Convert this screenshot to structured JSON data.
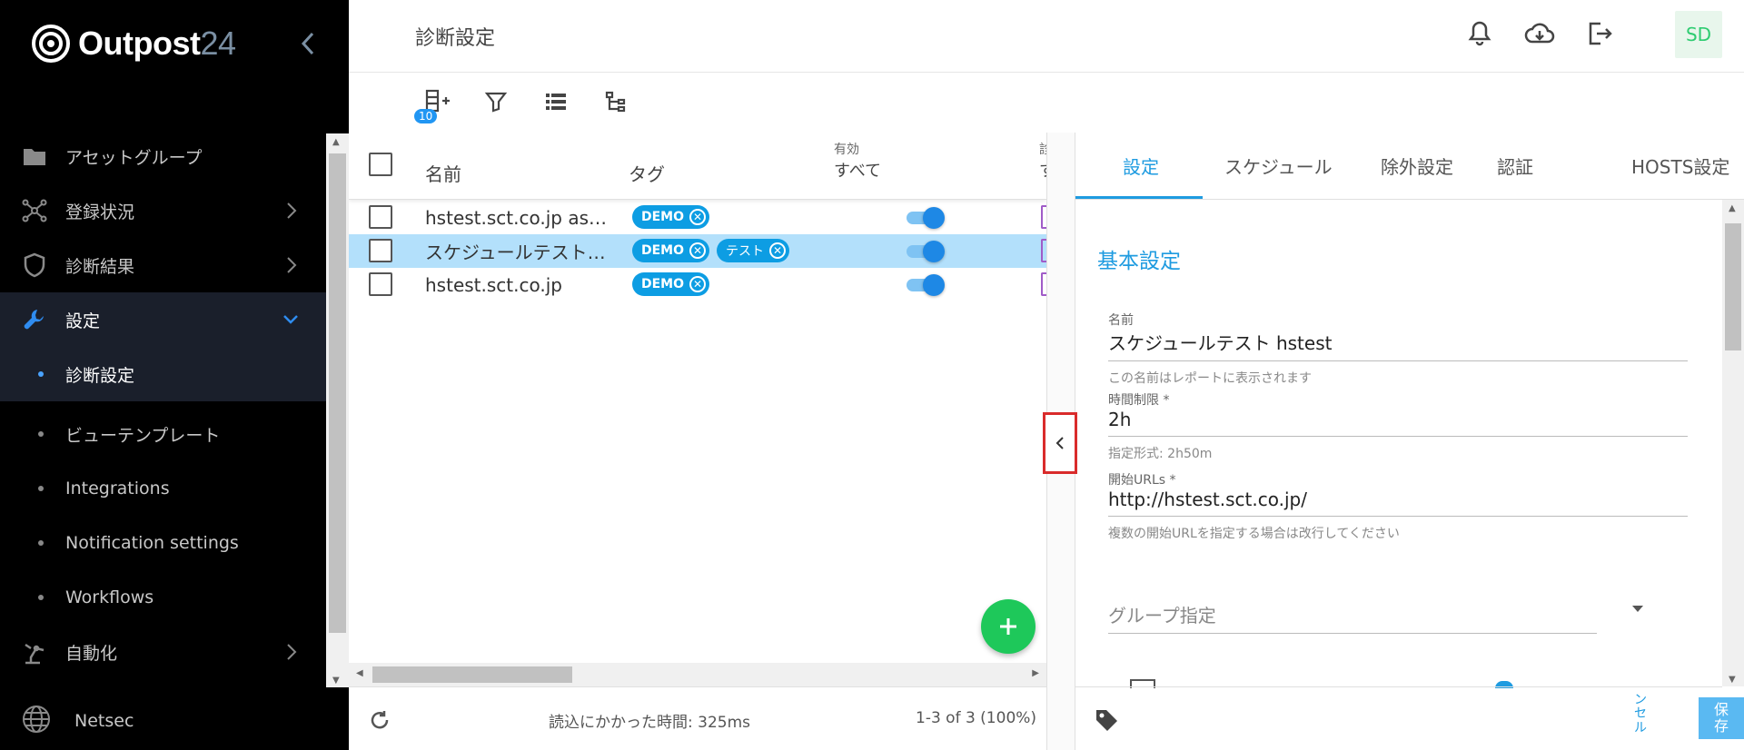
{
  "brand": {
    "name": "Outpost",
    "num": "24"
  },
  "sidebar": {
    "items": [
      {
        "label": "アセットグループ"
      },
      {
        "label": "登録状況"
      },
      {
        "label": "診断結果"
      },
      {
        "label": "設定"
      }
    ],
    "sub_items": [
      {
        "label": "診断設定"
      },
      {
        "label": "ビューテンプレート"
      },
      {
        "label": "Integrations"
      },
      {
        "label": "Notification settings"
      },
      {
        "label": "Workflows"
      }
    ],
    "automation": {
      "label": "自動化"
    },
    "netsec": {
      "label": "Netsec"
    }
  },
  "header": {
    "title": "診断設定",
    "avatar": "SD"
  },
  "toolbar": {
    "badge": "10"
  },
  "table": {
    "headers": {
      "select": "",
      "name": "名前",
      "tag": "タグ",
      "active_label": "有効",
      "active_filter": "すべて",
      "cut_label": "診",
      "cut_filter": "す"
    },
    "rows": [
      {
        "name": "hstest.sct.co.jp asset...",
        "tags": [
          "DEMO"
        ],
        "enabled": true
      },
      {
        "name": "スケジュールテスト ...",
        "tags": [
          "DEMO",
          "テスト"
        ],
        "enabled": true
      },
      {
        "name": "hstest.sct.co.jp",
        "tags": [
          "DEMO"
        ],
        "enabled": true
      }
    ]
  },
  "footer": {
    "load_time": "読込にかかった時間: 325ms",
    "count": "1-3 of 3 (100%)"
  },
  "panel": {
    "tabs": [
      "設定",
      "スケジュール",
      "除外設定",
      "認証",
      "HOSTS設定"
    ],
    "section": "基本設定",
    "fields": [
      {
        "label": "名前",
        "value": "スケジュールテスト hstest",
        "hint": "この名前はレポートに表示されます"
      },
      {
        "label": "時間制限 *",
        "value": "2h",
        "hint": "指定形式: 2h50m"
      },
      {
        "label": "開始URLs *",
        "value": "http://hstest.sct.co.jp/",
        "hint": "複数の開始URLを指定する場合は改行してください"
      }
    ],
    "group_placeholder": "グループ指定",
    "cancel": "ンセル",
    "save_1": "保",
    "save_2": "存"
  },
  "colors": {
    "accent": "#1e9be0",
    "chip": "#0d9de3",
    "fab": "#1ec85a",
    "selected_row": "#b3e0fb",
    "sidebar_bg": "#000000"
  }
}
